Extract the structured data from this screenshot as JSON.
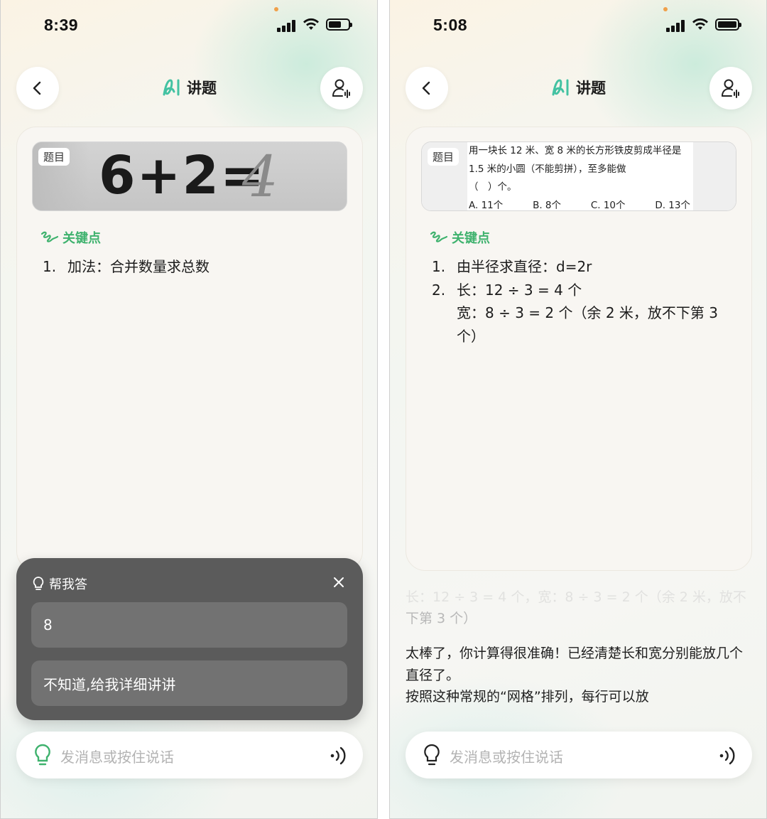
{
  "screens": [
    {
      "status": {
        "time": "8:39"
      },
      "nav": {
        "title": "讲题"
      },
      "question": {
        "tag": "题目",
        "photo_text": "6+2=",
        "photo_answer": "4"
      },
      "key_points": {
        "heading": "关键点",
        "items": [
          {
            "num": "1.",
            "text": "加法：合并数量求总数"
          }
        ]
      },
      "help_panel": {
        "title": "帮我答",
        "options": [
          "8",
          "不知道,给我详细讲讲"
        ]
      },
      "input": {
        "placeholder": "发消息或按住说话"
      }
    },
    {
      "status": {
        "time": "5:08"
      },
      "nav": {
        "title": "讲题"
      },
      "question": {
        "tag": "题目",
        "line1": "用一块长 12 米、宽 8 米的长方形铁皮剪成半径是",
        "line2": "1.5 米的小圆（不能剪拼），至多能做",
        "line3": "（　）个。",
        "options": [
          "A. 11个",
          "B. 8个",
          "C. 10个",
          "D. 13个"
        ]
      },
      "key_points": {
        "heading": "关键点",
        "items": [
          {
            "num": "1.",
            "text": "由半径求直径：d=2r"
          },
          {
            "num": "2.",
            "text": "长：12 ÷ 3 = 4 个"
          },
          {
            "num": "",
            "text": "宽：8 ÷ 3 = 2 个（余 2 米，放不下第 3 个）"
          }
        ]
      },
      "chat": {
        "faded_line1": "长：12 ÷ 3 = 4 个，宽：8 ÷ 3 = 2 个（余 2 米，放不",
        "faded_line2": "下第 3 个）",
        "message_line1": "太棒了，你计算得很准确！已经清楚长和宽分别能放几个直径了。",
        "message_line2": "按照这种常规的“网格”排列，每行可以放"
      },
      "input": {
        "placeholder": "发消息或按住说话"
      }
    }
  ],
  "colors": {
    "accent_green": "#3fb26e",
    "help_bg": "#5b5b5b",
    "help_option_bg": "#727272"
  },
  "icons": [
    "back-chevron-icon",
    "ai-logo-icon",
    "voice-profile-icon",
    "scribble-icon",
    "lightbulb-icon",
    "close-icon",
    "sound-wave-icon",
    "signal-icon",
    "wifi-icon",
    "battery-icon"
  ]
}
